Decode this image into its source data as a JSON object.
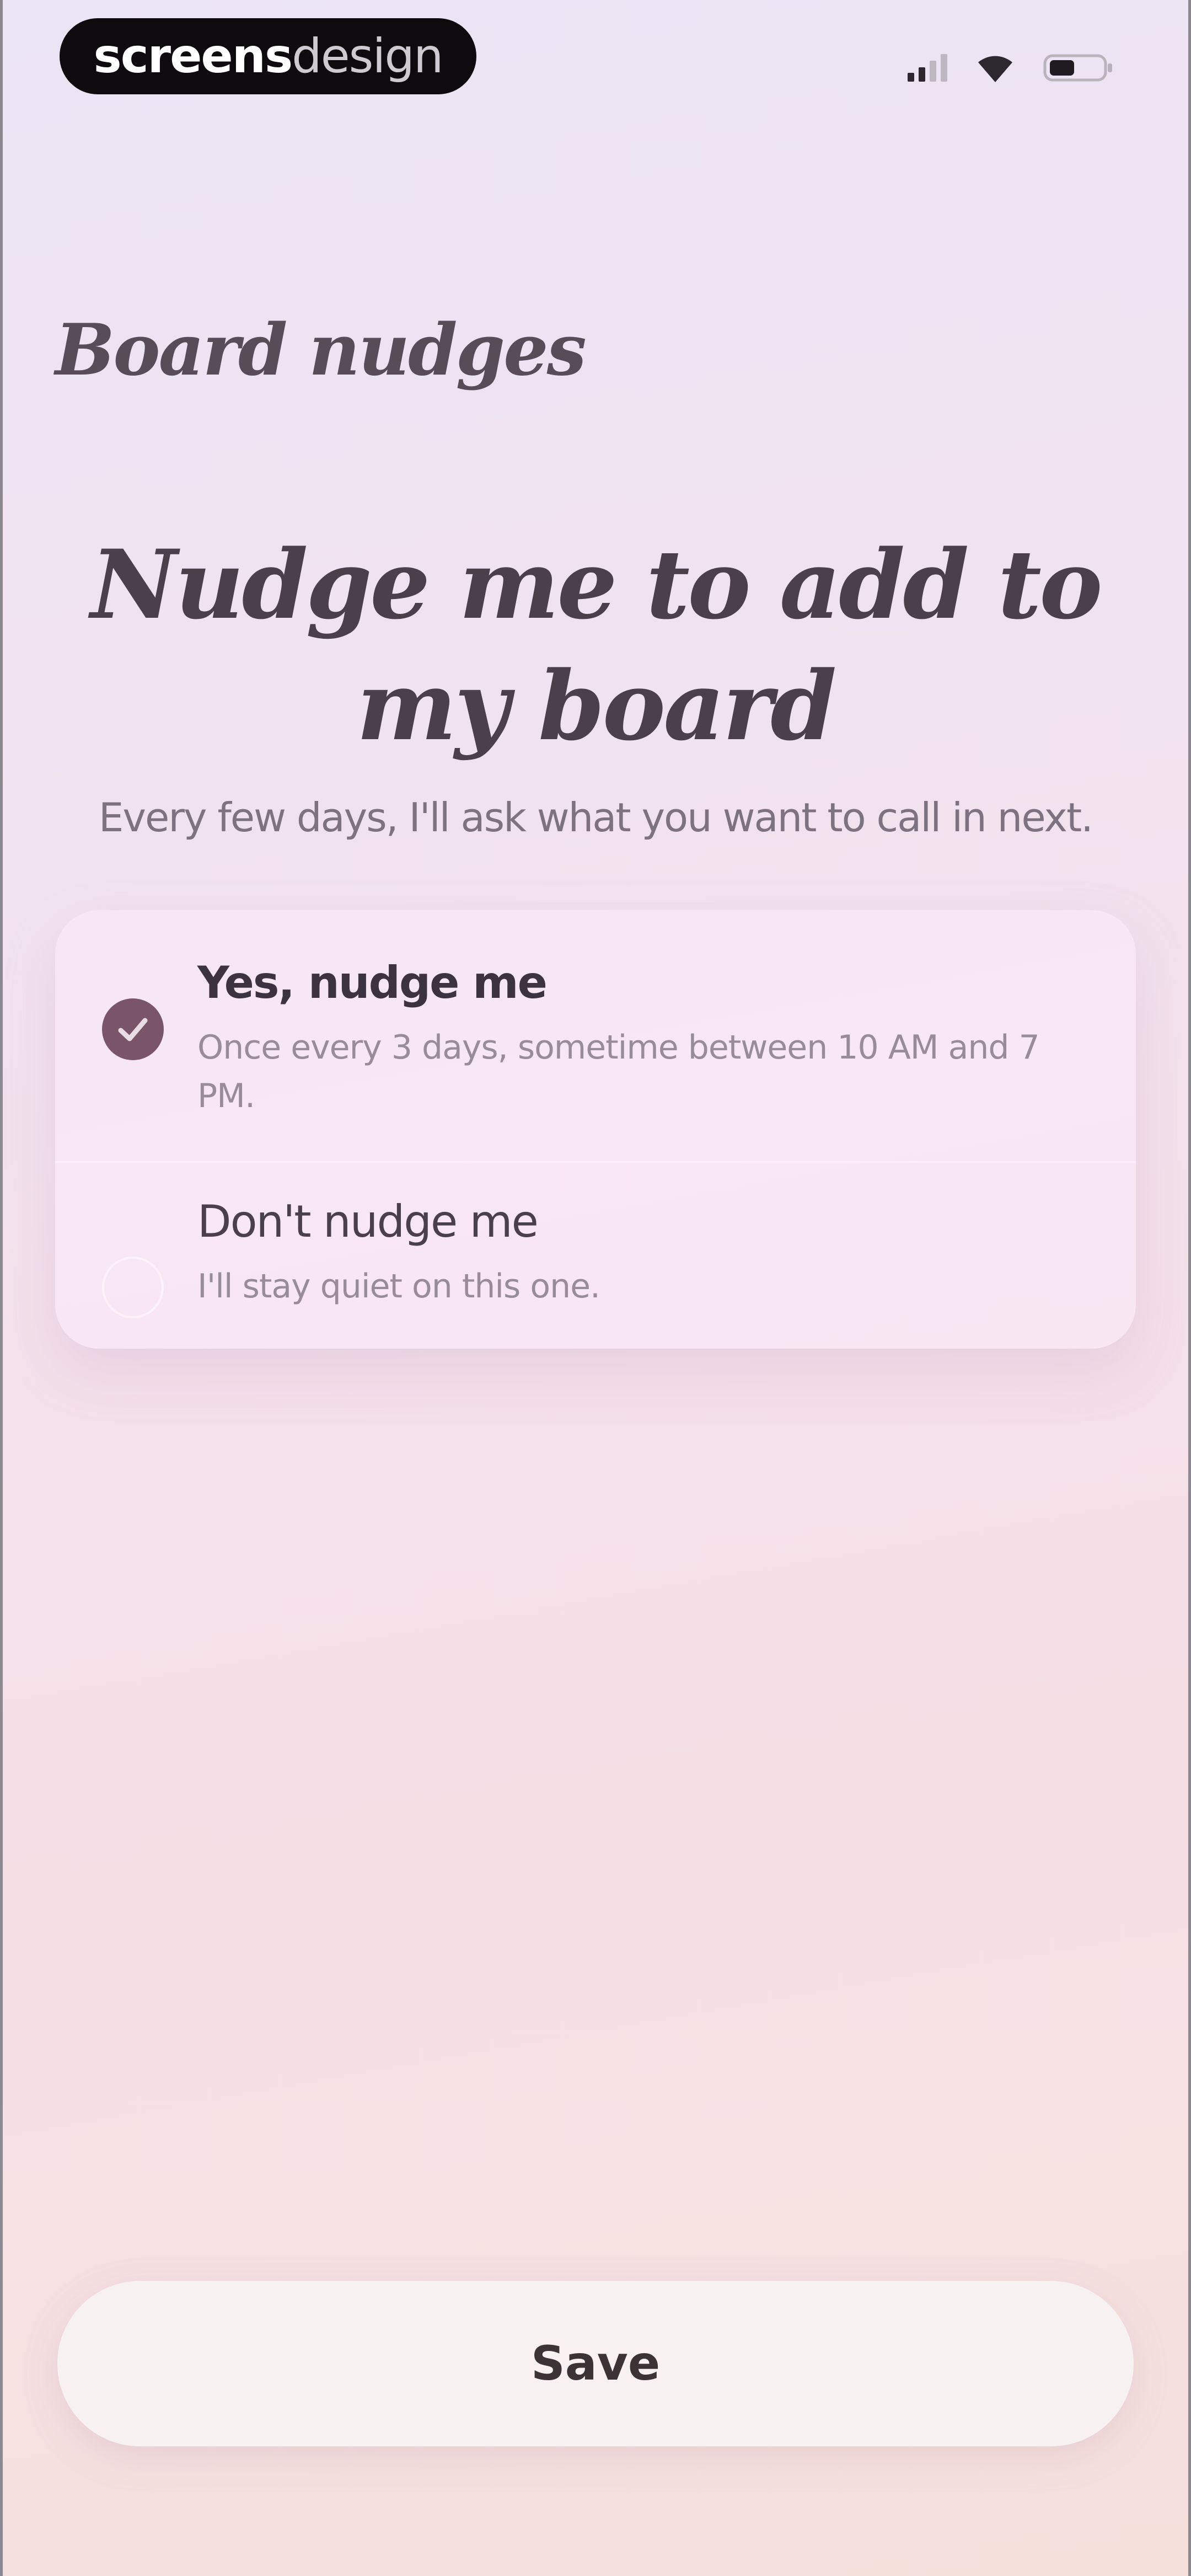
{
  "status_bar": {
    "brand_bold": "screens",
    "brand_light": "design",
    "icons": [
      "signal-icon",
      "wifi-icon",
      "battery-icon"
    ]
  },
  "header": {
    "title": "Board nudges"
  },
  "main": {
    "headline": "Nudge me to add to my board",
    "subtitle": "Every few days, I'll ask what you want to call in next."
  },
  "options": [
    {
      "label": "Yes, nudge me",
      "description": "Once every 3 days, sometime between 10 AM and 7 PM.",
      "selected": true
    },
    {
      "label": "Don't nudge me",
      "description": "I'll stay quiet on this one.",
      "selected": false
    }
  ],
  "footer": {
    "save_label": "Save"
  },
  "colors": {
    "accent": "#7a5468",
    "background_top": "#ebe4f4",
    "background_bottom": "#f6e0dc",
    "card": "#f8e8f6"
  }
}
